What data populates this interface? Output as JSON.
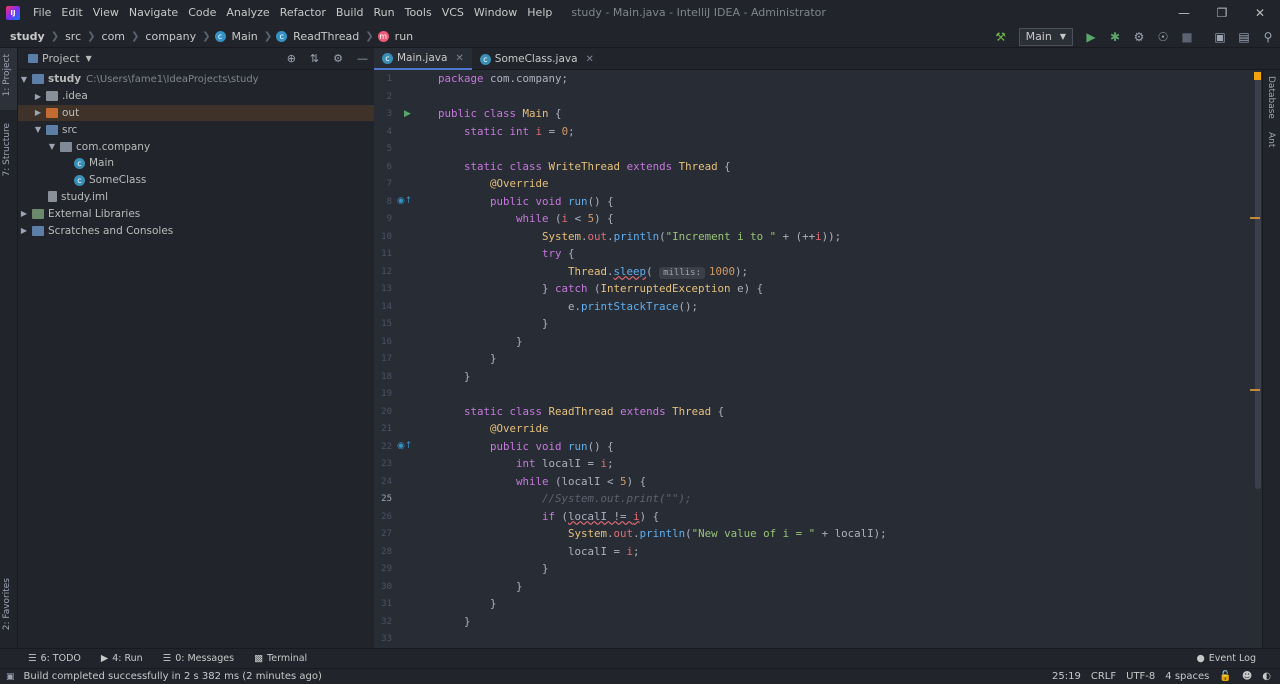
{
  "titlebar": {
    "menus": [
      "File",
      "Edit",
      "View",
      "Navigate",
      "Code",
      "Analyze",
      "Refactor",
      "Build",
      "Run",
      "Tools",
      "VCS",
      "Window",
      "Help"
    ],
    "title": "study - Main.java - IntelliJ IDEA - Administrator"
  },
  "navbar": {
    "crumbs": [
      "study",
      "src",
      "com",
      "company",
      "Main",
      "ReadThread",
      "run"
    ],
    "run_config": "Main"
  },
  "project": {
    "header": "Project",
    "tree": [
      {
        "label": "study",
        "path": "C:\\Users\\fame1\\IdeaProjects\\study"
      },
      {
        "label": ".idea"
      },
      {
        "label": "out"
      },
      {
        "label": "src"
      },
      {
        "label": "com.company"
      },
      {
        "label": "Main"
      },
      {
        "label": "SomeClass"
      },
      {
        "label": "study.iml"
      },
      {
        "label": "External Libraries"
      },
      {
        "label": "Scratches and Consoles"
      }
    ]
  },
  "left_tabs": [
    "1: Project",
    "7: Structure",
    "2: Favorites"
  ],
  "right_tabs": [
    "Database",
    "Ant"
  ],
  "tabs": [
    "Main.java",
    "SomeClass.java"
  ],
  "editor": {
    "line_numbers": [
      "1",
      "2",
      "3",
      "4",
      "5",
      "6",
      "7",
      "8",
      "9",
      "10",
      "11",
      "12",
      "13",
      "14",
      "15",
      "16",
      "17",
      "18",
      "19",
      "20",
      "21",
      "22",
      "23",
      "24",
      "25",
      "26",
      "27",
      "28",
      "29",
      "30",
      "31",
      "32",
      "33"
    ],
    "param_hint": "millis:",
    "current_line": 25
  },
  "bottom_tabs": [
    "6: TODO",
    "4: Run",
    "0: Messages",
    "Terminal"
  ],
  "event_log": "Event Log",
  "status": {
    "message": "Build completed successfully in 2 s 382 ms (2 minutes ago)",
    "position": "25:19",
    "line_sep": "CRLF",
    "encoding": "UTF-8",
    "indent": "4 spaces"
  }
}
